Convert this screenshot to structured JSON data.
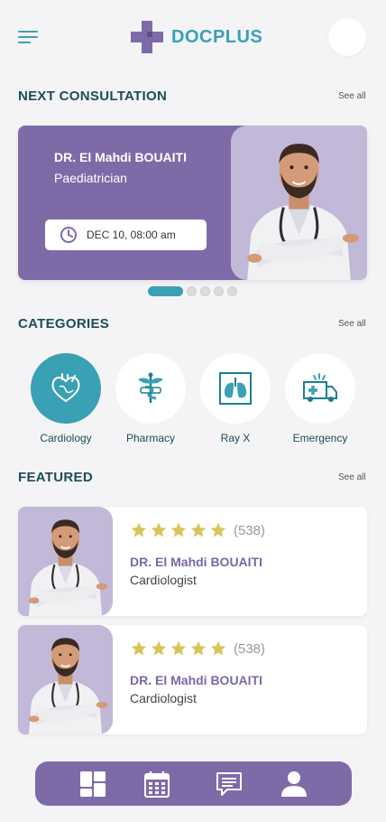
{
  "header": {
    "brand": "DOCPLUS",
    "brand_color": "#3aa0b4"
  },
  "next_consultation": {
    "title": "NEXT CONSULTATION",
    "see_all": "See all",
    "doctor_name": "DR. El Mahdi BOUAITI",
    "specialty": "Paediatrician",
    "datetime": "DEC 10, 08:00 am",
    "card_color": "#7f6aa8",
    "carousel_pages": 5,
    "carousel_active": 1
  },
  "categories": {
    "title": "CATEGORIES",
    "see_all": "See all",
    "items": [
      {
        "label": "Cardiology",
        "icon": "heart-icon",
        "active": true
      },
      {
        "label": "Pharmacy",
        "icon": "caduceus-icon",
        "active": false
      },
      {
        "label": "Ray X",
        "icon": "lungs-xray-icon",
        "active": false
      },
      {
        "label": "Emergency",
        "icon": "ambulance-icon",
        "active": false
      }
    ]
  },
  "featured": {
    "title": "FEATURED",
    "see_all": "See all",
    "items": [
      {
        "rating": 5,
        "reviews": "(538)",
        "doctor_name": "DR. El Mahdi BOUAITI",
        "specialty": "Cardiologist"
      },
      {
        "rating": 5,
        "reviews": "(538)",
        "doctor_name": "DR. El Mahdi BOUAITI",
        "specialty": "Cardiologist"
      }
    ]
  },
  "bottom_nav": {
    "items": [
      "dashboard-icon",
      "calendar-icon",
      "chat-icon",
      "profile-icon"
    ]
  },
  "colors": {
    "teal": "#3aa0b4",
    "purple": "#7f6aa8",
    "star": "#d9c55a"
  }
}
